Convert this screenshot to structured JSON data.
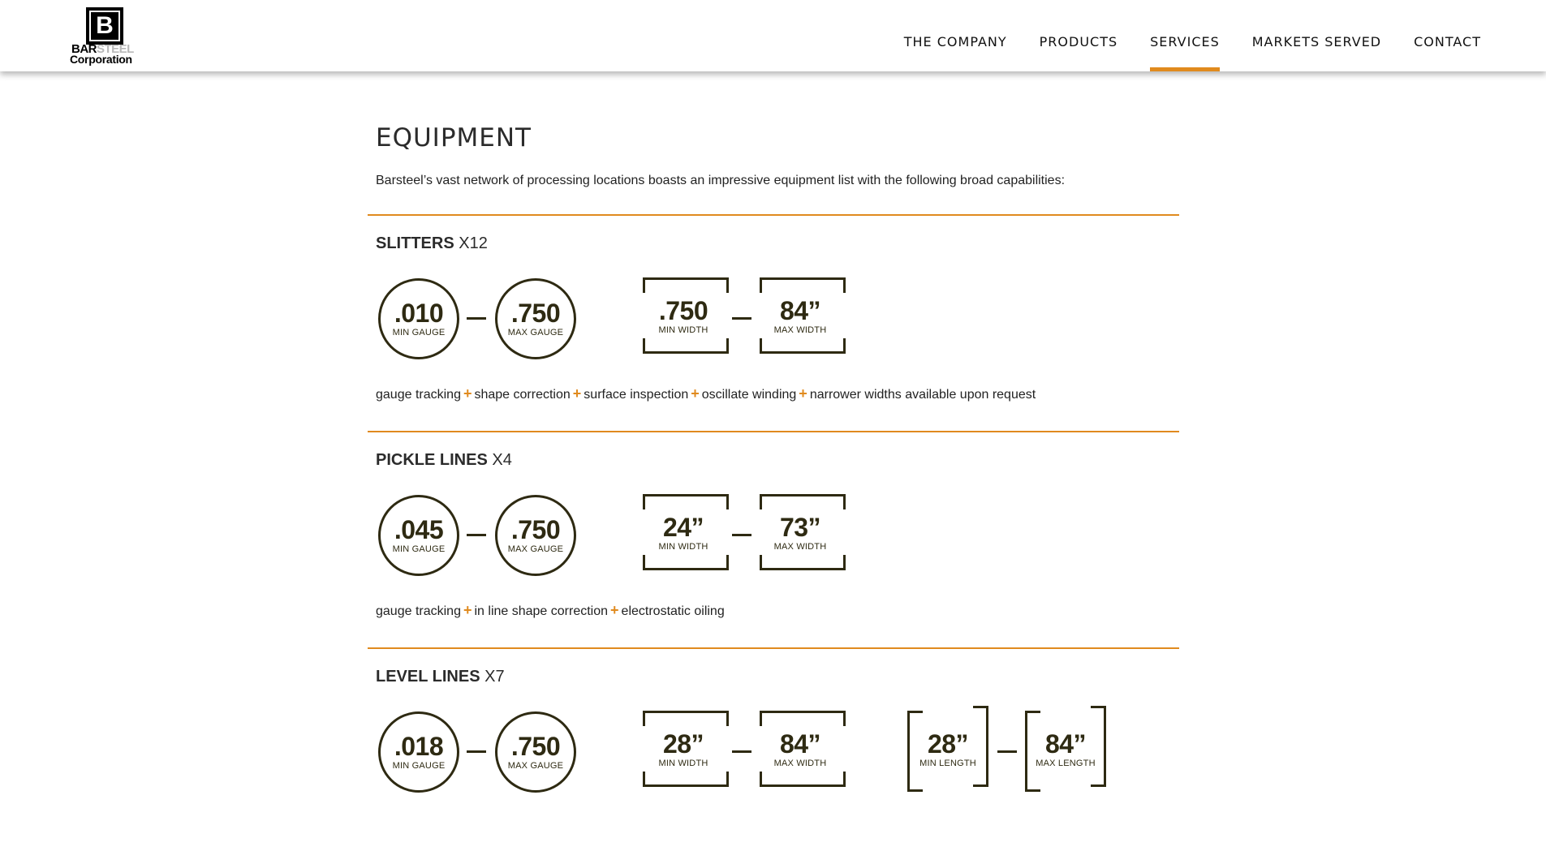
{
  "logo": {
    "mark": "B",
    "text_bar": "BAR",
    "text_steel": "STEEL",
    "text_corp": "Corporation"
  },
  "nav": [
    {
      "label": "THE COMPANY",
      "active": false
    },
    {
      "label": "PRODUCTS",
      "active": false
    },
    {
      "label": "SERVICES",
      "active": true
    },
    {
      "label": "MARKETS SERVED",
      "active": false
    },
    {
      "label": "CONTACT",
      "active": false
    }
  ],
  "page": {
    "title": "EQUIPMENT",
    "intro": "Barsteel’s vast network of processing locations boasts an impressive equipment list with the following broad capabilities:"
  },
  "sections": [
    {
      "name": "SLITTERS",
      "count": "X12",
      "min_gauge": {
        "value": ".010",
        "label": "MIN GAUGE"
      },
      "max_gauge": {
        "value": ".750",
        "label": "MAX GAUGE"
      },
      "min_width": {
        "value": ".750",
        "label": "MIN WIDTH"
      },
      "max_width": {
        "value": "84”",
        "label": "MAX WIDTH"
      },
      "features": [
        "gauge tracking",
        "shape correction",
        "surface inspection",
        "oscillate winding",
        "narrower widths available upon request"
      ]
    },
    {
      "name": "PICKLE LINES",
      "count": "X4",
      "min_gauge": {
        "value": ".045",
        "label": "MIN GAUGE"
      },
      "max_gauge": {
        "value": ".750",
        "label": "MAX GAUGE"
      },
      "min_width": {
        "value": "24”",
        "label": "MIN WIDTH"
      },
      "max_width": {
        "value": "73”",
        "label": "MAX WIDTH"
      },
      "features": [
        "gauge tracking",
        "in line shape correction",
        "electrostatic oiling"
      ]
    },
    {
      "name": "LEVEL LINES",
      "count": "X7",
      "min_gauge": {
        "value": ".018",
        "label": "MIN GAUGE"
      },
      "max_gauge": {
        "value": ".750",
        "label": "MAX GAUGE"
      },
      "min_width": {
        "value": "28”",
        "label": "MIN WIDTH"
      },
      "max_width": {
        "value": "84”",
        "label": "MAX WIDTH"
      },
      "min_length": {
        "value": "28”",
        "label": "MIN LENGTH"
      },
      "max_length": {
        "value": "84”",
        "label": "MAX LENGTH"
      }
    }
  ],
  "colors": {
    "accent": "#e08a1e",
    "spec": "#2e2a12"
  }
}
